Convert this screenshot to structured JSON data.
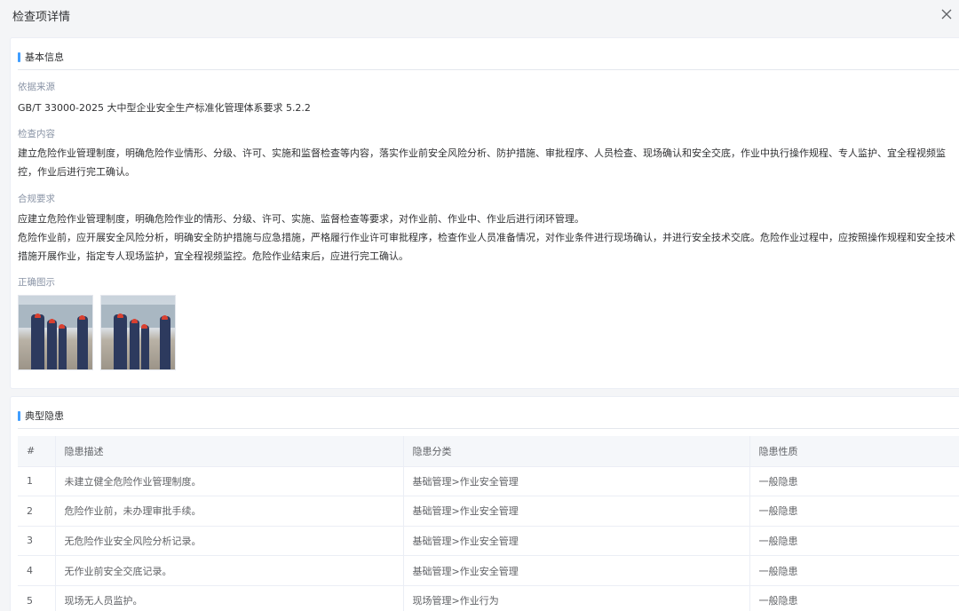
{
  "dialog": {
    "title": "检查项详情",
    "close_icon": "close-icon"
  },
  "basic_info": {
    "section_title": "基本信息",
    "source_label": "依据来源",
    "source_value": "GB/T 33000-2025 大中型企业安全生产标准化管理体系要求 5.2.2",
    "content_label": "检查内容",
    "content_value": "建立危险作业管理制度，明确危险作业情形、分级、许可、实施和监督检查等内容，落实作业前安全风险分析、防护措施、审批程序、人员检查、现场确认和安全交底，作业中执行操作规程、专人监护、宜全程视频监控，作业后进行完工确认。",
    "compliance_label": "合规要求",
    "compliance_line1": "应建立危险作业管理制度，明确危险作业的情形、分级、许可、实施、监督检查等要求，对作业前、作业中、作业后进行闭环管理。",
    "compliance_line2": "危险作业前，应开展安全风险分析，明确安全防护措施与应急措施，严格履行作业许可审批程序，检查作业人员准备情况，对作业条件进行现场确认，并进行安全技术交底。危险作业过程中，应按照操作规程和安全技术措施开展作业，指定专人现场监护，宜全程视频监控。危险作业结束后，应进行完工确认。",
    "example_label": "正确图示"
  },
  "hazards": {
    "section_title": "典型隐患",
    "columns": [
      "#",
      "隐患描述",
      "隐患分类",
      "隐患性质"
    ],
    "rows": [
      {
        "no": "1",
        "desc": "未建立健全危险作业管理制度。",
        "category": "基础管理>作业安全管理",
        "nature": "一般隐患"
      },
      {
        "no": "2",
        "desc": "危险作业前，未办理审批手续。",
        "category": "基础管理>作业安全管理",
        "nature": "一般隐患"
      },
      {
        "no": "3",
        "desc": "无危险作业安全风险分析记录。",
        "category": "基础管理>作业安全管理",
        "nature": "一般隐患"
      },
      {
        "no": "4",
        "desc": "无作业前安全交底记录。",
        "category": "基础管理>作业安全管理",
        "nature": "一般隐患"
      },
      {
        "no": "5",
        "desc": "现场无人员监护。",
        "category": "现场管理>作业行为",
        "nature": "一般隐患"
      }
    ]
  },
  "colors": {
    "accent": "#409eff",
    "nature": "#e6a23c",
    "label": "#8a94a6"
  }
}
